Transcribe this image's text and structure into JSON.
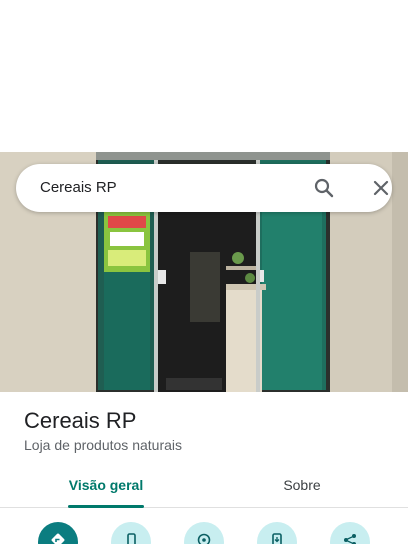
{
  "search": {
    "query": "Cereais RP"
  },
  "place": {
    "name": "Cereais RP",
    "category": "Loja de produtos naturais"
  },
  "tabs": [
    {
      "label": "Visão geral",
      "selected": true
    },
    {
      "label": "Sobre",
      "selected": false
    }
  ],
  "actions": [
    {
      "icon": "directions-icon",
      "primary": true
    },
    {
      "icon": "phone-icon",
      "primary": false
    },
    {
      "icon": "location-icon",
      "primary": false
    },
    {
      "icon": "save-to-phone-icon",
      "primary": false
    },
    {
      "icon": "share-icon",
      "primary": false
    }
  ],
  "colors": {
    "accent": "#00796b",
    "action_primary": "#0b7d80",
    "action_secondary": "#c8eef0"
  }
}
